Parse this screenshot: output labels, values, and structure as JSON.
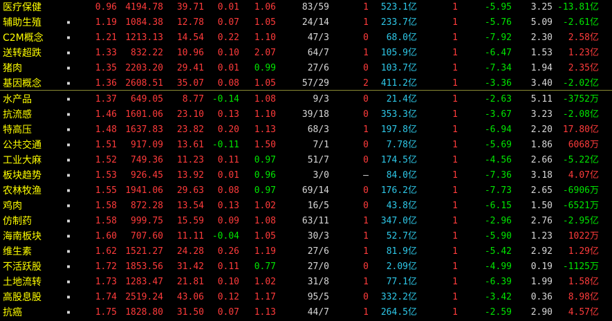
{
  "rows": [
    {
      "name": "医疗保健",
      "dot": "",
      "c1": "0.96",
      "c2": "4194.78",
      "c3": "39.71",
      "c4": "0.01",
      "c5": "1.06",
      "c6": "83/59",
      "c7": "1",
      "c8": "523.1亿",
      "c9": "1",
      "c10": "-5.95",
      "c11": "3.25",
      "c12": "-13.81亿",
      "c5color": "red",
      "c7color": "red",
      "c12color": "green"
    },
    {
      "name": "辅助生殖",
      "dot": "▪",
      "c1": "1.19",
      "c2": "1084.38",
      "c3": "12.78",
      "c4": "0.07",
      "c5": "1.05",
      "c6": "24/14",
      "c7": "1",
      "c8": "233.7亿",
      "c9": "1",
      "c10": "-5.76",
      "c11": "5.09",
      "c12": "-2.61亿",
      "c5color": "red",
      "c7color": "red",
      "c12color": "green"
    },
    {
      "name": "C2M概念",
      "dot": "▪",
      "c1": "1.21",
      "c2": "1213.13",
      "c3": "14.54",
      "c4": "0.22",
      "c5": "1.10",
      "c6": "47/3",
      "c7": "0",
      "c8": "68.0亿",
      "c9": "1",
      "c10": "-7.92",
      "c11": "2.30",
      "c12": "2.58亿",
      "c5color": "red",
      "c7color": "red",
      "c12color": "red"
    },
    {
      "name": "送转超跌",
      "dot": "▪",
      "c1": "1.33",
      "c2": "832.22",
      "c3": "10.96",
      "c4": "0.10",
      "c5": "2.07",
      "c6": "64/7",
      "c7": "1",
      "c8": "105.9亿",
      "c9": "1",
      "c10": "-6.47",
      "c11": "1.53",
      "c12": "1.23亿",
      "c5color": "red",
      "c7color": "red",
      "c12color": "red"
    },
    {
      "name": "猪肉",
      "dot": "▪",
      "c1": "1.35",
      "c2": "2203.20",
      "c3": "29.41",
      "c4": "0.01",
      "c5": "0.99",
      "c6": "27/6",
      "c7": "0",
      "c8": "103.7亿",
      "c9": "1",
      "c10": "-7.34",
      "c11": "1.94",
      "c12": "2.35亿",
      "c5color": "green",
      "c7color": "red",
      "c12color": "red"
    },
    {
      "name": "基因概念",
      "dot": "▪",
      "c1": "1.36",
      "c2": "2608.51",
      "c3": "35.07",
      "c4": "0.08",
      "c5": "1.05",
      "c6": "57/29",
      "c7": "2",
      "c8": "411.2亿",
      "c9": "1",
      "c10": "-3.36",
      "c11": "3.40",
      "c12": "-2.02亿",
      "c5color": "red",
      "c7color": "red",
      "c12color": "green"
    },
    {
      "name": "水产品",
      "dot": "▪",
      "c1": "1.37",
      "c2": "649.05",
      "c3": "8.77",
      "c4": "-0.14",
      "c5": "1.08",
      "c6": "9/3",
      "c7": "0",
      "c8": "21.4亿",
      "c9": "1",
      "c10": "-2.63",
      "c11": "5.11",
      "c12": "-3752万",
      "c5color": "red",
      "c7color": "red",
      "c12color": "green"
    },
    {
      "name": "抗流感",
      "dot": "▪",
      "c1": "1.46",
      "c2": "1601.06",
      "c3": "23.10",
      "c4": "0.13",
      "c5": "1.10",
      "c6": "39/18",
      "c7": "0",
      "c8": "353.3亿",
      "c9": "1",
      "c10": "-3.67",
      "c11": "3.23",
      "c12": "-2.08亿",
      "c5color": "red",
      "c7color": "red",
      "c12color": "green"
    },
    {
      "name": "特高压",
      "dot": "▪",
      "c1": "1.48",
      "c2": "1637.83",
      "c3": "23.82",
      "c4": "0.20",
      "c5": "1.13",
      "c6": "68/3",
      "c7": "1",
      "c8": "197.8亿",
      "c9": "1",
      "c10": "-6.94",
      "c11": "2.20",
      "c12": "17.80亿",
      "c5color": "red",
      "c7color": "red",
      "c12color": "red"
    },
    {
      "name": "公共交通",
      "dot": "▪",
      "c1": "1.51",
      "c2": "917.09",
      "c3": "13.61",
      "c4": "-0.11",
      "c5": "1.50",
      "c6": "7/1",
      "c7": "0",
      "c8": "7.78亿",
      "c9": "1",
      "c10": "-5.69",
      "c11": "1.86",
      "c12": "6068万",
      "c5color": "red",
      "c7color": "red",
      "c12color": "red"
    },
    {
      "name": "工业大麻",
      "dot": "▪",
      "c1": "1.52",
      "c2": "749.36",
      "c3": "11.23",
      "c4": "0.11",
      "c5": "0.97",
      "c6": "51/7",
      "c7": "0",
      "c8": "174.5亿",
      "c9": "1",
      "c10": "-4.56",
      "c11": "2.66",
      "c12": "-5.22亿",
      "c5color": "green",
      "c7color": "red",
      "c12color": "green"
    },
    {
      "name": "板块趋势",
      "dot": "▪",
      "c1": "1.53",
      "c2": "926.45",
      "c3": "13.92",
      "c4": "0.01",
      "c5": "0.96",
      "c6": "3/0",
      "c7": "–",
      "c8": "84.0亿",
      "c9": "1",
      "c10": "-7.36",
      "c11": "3.18",
      "c12": "4.07亿",
      "c5color": "green",
      "c7color": "white",
      "c12color": "red"
    },
    {
      "name": "农林牧渔",
      "dot": "▪",
      "c1": "1.55",
      "c2": "1941.06",
      "c3": "29.63",
      "c4": "0.08",
      "c5": "0.97",
      "c6": "69/14",
      "c7": "0",
      "c8": "176.2亿",
      "c9": "1",
      "c10": "-7.73",
      "c11": "2.65",
      "c12": "-6906万",
      "c5color": "green",
      "c7color": "red",
      "c12color": "green"
    },
    {
      "name": "鸡肉",
      "dot": "▪",
      "c1": "1.58",
      "c2": "872.28",
      "c3": "13.54",
      "c4": "0.13",
      "c5": "1.02",
      "c6": "16/5",
      "c7": "0",
      "c8": "43.8亿",
      "c9": "1",
      "c10": "-6.15",
      "c11": "1.50",
      "c12": "-6521万",
      "c5color": "red",
      "c7color": "red",
      "c12color": "green"
    },
    {
      "name": "仿制药",
      "dot": "▪",
      "c1": "1.58",
      "c2": "999.75",
      "c3": "15.59",
      "c4": "0.09",
      "c5": "1.08",
      "c6": "63/11",
      "c7": "1",
      "c8": "347.0亿",
      "c9": "1",
      "c10": "-2.96",
      "c11": "2.76",
      "c12": "-2.95亿",
      "c5color": "red",
      "c7color": "red",
      "c12color": "green"
    },
    {
      "name": "海南板块",
      "dot": "▪",
      "c1": "1.60",
      "c2": "707.60",
      "c3": "11.11",
      "c4": "-0.04",
      "c5": "1.05",
      "c6": "30/3",
      "c7": "1",
      "c8": "52.7亿",
      "c9": "1",
      "c10": "-5.90",
      "c11": "1.23",
      "c12": "1022万",
      "c5color": "red",
      "c7color": "red",
      "c12color": "red"
    },
    {
      "name": "维生素",
      "dot": "▪",
      "c1": "1.62",
      "c2": "1521.27",
      "c3": "24.28",
      "c4": "0.26",
      "c5": "1.19",
      "c6": "27/6",
      "c7": "1",
      "c8": "81.9亿",
      "c9": "1",
      "c10": "-5.42",
      "c11": "2.92",
      "c12": "1.29亿",
      "c5color": "red",
      "c7color": "red",
      "c12color": "red"
    },
    {
      "name": "不活跃股",
      "dot": "▪",
      "c1": "1.72",
      "c2": "1853.56",
      "c3": "31.42",
      "c4": "0.11",
      "c5": "0.77",
      "c6": "27/0",
      "c7": "0",
      "c8": "2.09亿",
      "c9": "1",
      "c10": "-4.99",
      "c11": "0.19",
      "c12": "-1125万",
      "c5color": "green",
      "c7color": "red",
      "c12color": "green"
    },
    {
      "name": "土地流转",
      "dot": "▪",
      "c1": "1.73",
      "c2": "1283.47",
      "c3": "21.81",
      "c4": "0.10",
      "c5": "1.02",
      "c6": "31/8",
      "c7": "1",
      "c8": "77.1亿",
      "c9": "1",
      "c10": "-6.39",
      "c11": "1.99",
      "c12": "1.58亿",
      "c5color": "red",
      "c7color": "red",
      "c12color": "red"
    },
    {
      "name": "高股息股",
      "dot": "▪",
      "c1": "1.74",
      "c2": "2519.24",
      "c3": "43.06",
      "c4": "0.12",
      "c5": "1.17",
      "c6": "95/5",
      "c7": "0",
      "c8": "332.2亿",
      "c9": "1",
      "c10": "-3.42",
      "c11": "0.36",
      "c12": "8.98亿",
      "c5color": "red",
      "c7color": "red",
      "c12color": "red"
    },
    {
      "name": "抗癌",
      "dot": "▪",
      "c1": "1.75",
      "c2": "1828.80",
      "c3": "31.50",
      "c4": "0.07",
      "c5": "1.13",
      "c6": "44/7",
      "c7": "1",
      "c8": "264.5亿",
      "c9": "1",
      "c10": "-2.59",
      "c11": "2.90",
      "c12": "4.57亿",
      "c5color": "red",
      "c7color": "red",
      "c12color": "red"
    }
  ]
}
